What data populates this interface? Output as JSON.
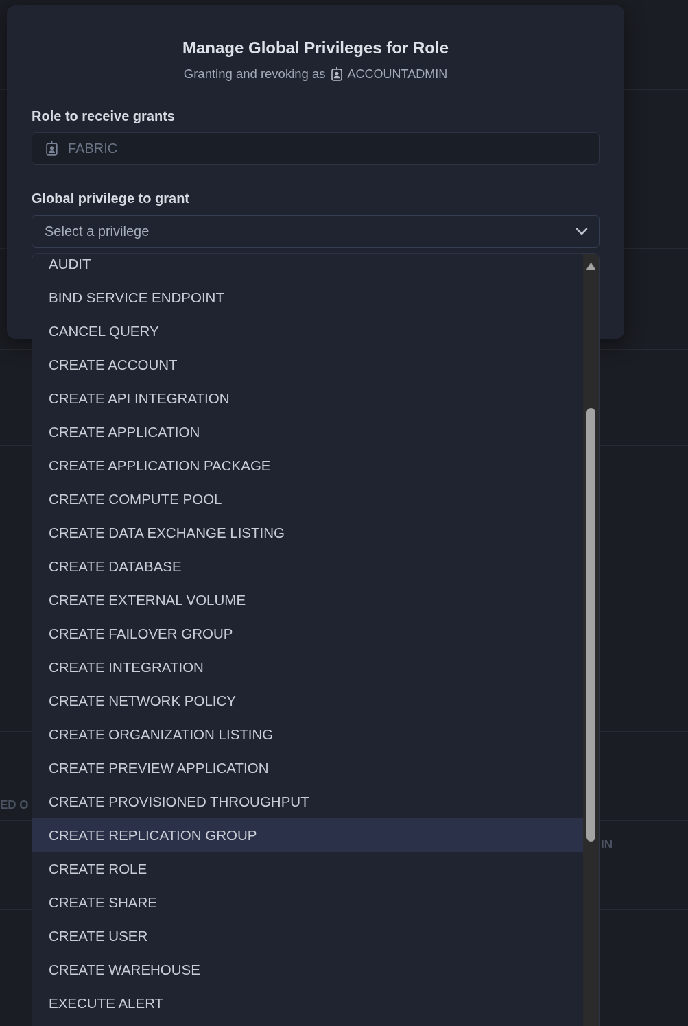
{
  "background_table": {
    "header_texts": [
      "ED O",
      "IN"
    ]
  },
  "dialog": {
    "title": "Manage Global Privileges for Role",
    "subtitle": {
      "text": "Granting and revoking as",
      "role": "ACCOUNTADMIN"
    },
    "fields": [
      {
        "kind": "role",
        "label": "Role to receive grants",
        "value": "FABRIC",
        "disabled": true
      },
      {
        "kind": "select",
        "label": "Global privilege to grant",
        "placeholder": "Select a privilege",
        "expanded": true
      }
    ]
  },
  "dropdown": {
    "options": [
      {
        "label": "AUDIT",
        "selected": false
      },
      {
        "label": "BIND SERVICE ENDPOINT",
        "selected": false
      },
      {
        "label": "CANCEL QUERY",
        "selected": false
      },
      {
        "label": "CREATE ACCOUNT",
        "selected": false
      },
      {
        "label": "CREATE API INTEGRATION",
        "selected": false
      },
      {
        "label": "CREATE APPLICATION",
        "selected": false
      },
      {
        "label": "CREATE APPLICATION PACKAGE",
        "selected": false
      },
      {
        "label": "CREATE COMPUTE POOL",
        "selected": false
      },
      {
        "label": "CREATE DATA EXCHANGE LISTING",
        "selected": false
      },
      {
        "label": "CREATE DATABASE",
        "selected": false
      },
      {
        "label": "CREATE EXTERNAL VOLUME",
        "selected": false
      },
      {
        "label": "CREATE FAILOVER GROUP",
        "selected": false
      },
      {
        "label": "CREATE INTEGRATION",
        "selected": false
      },
      {
        "label": "CREATE NETWORK POLICY",
        "selected": false
      },
      {
        "label": "CREATE ORGANIZATION LISTING",
        "selected": false
      },
      {
        "label": "CREATE PREVIEW APPLICATION",
        "selected": false
      },
      {
        "label": "CREATE PROVISIONED THROUGHPUT",
        "selected": false
      },
      {
        "label": "CREATE REPLICATION GROUP",
        "selected": true
      },
      {
        "label": "CREATE ROLE",
        "selected": false
      },
      {
        "label": "CREATE SHARE",
        "selected": false
      },
      {
        "label": "CREATE USER",
        "selected": false
      },
      {
        "label": "CREATE WAREHOUSE",
        "selected": false
      },
      {
        "label": "EXECUTE ALERT",
        "selected": false
      }
    ]
  }
}
